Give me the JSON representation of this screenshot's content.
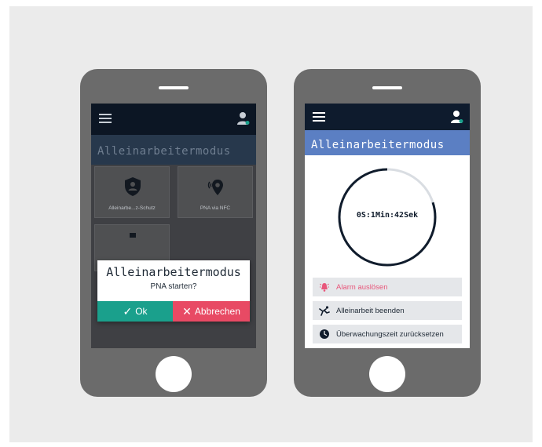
{
  "left_phone": {
    "title": "Alleinarbeitermodus",
    "tiles": [
      {
        "label": "Alleinarbe...z-Schutz",
        "icon": "shield-person-icon"
      },
      {
        "label": "PNA via NFC",
        "icon": "nfc-location-icon"
      },
      {
        "label": "",
        "icon": "lamp-icon"
      }
    ],
    "dialog": {
      "title": "Alleinarbeitermodus",
      "message": "PNA starten?",
      "ok_glyph": "✓",
      "ok_label": "Ok",
      "cancel_glyph": "✕",
      "cancel_label": "Abbrechen"
    }
  },
  "right_phone": {
    "title": "Alleinarbeitermodus",
    "timer": "0S:1Min:42Sek",
    "timer_progress": 0.2,
    "actions": [
      {
        "label": "Alarm auslösen",
        "icon": "alarm-bell-icon",
        "color": "#e8567a"
      },
      {
        "label": "Alleinarbeit beenden",
        "icon": "person-running-icon",
        "color": "#1f2a36"
      },
      {
        "label": "Überwachungszeit zurücksetzen",
        "icon": "clock-reset-icon",
        "color": "#1f2a36"
      }
    ]
  },
  "colors": {
    "ok": "#1aa08c",
    "cancel": "#e84a64",
    "accent_blue": "#5b7fc3",
    "navbar": "#0e1b2d"
  }
}
